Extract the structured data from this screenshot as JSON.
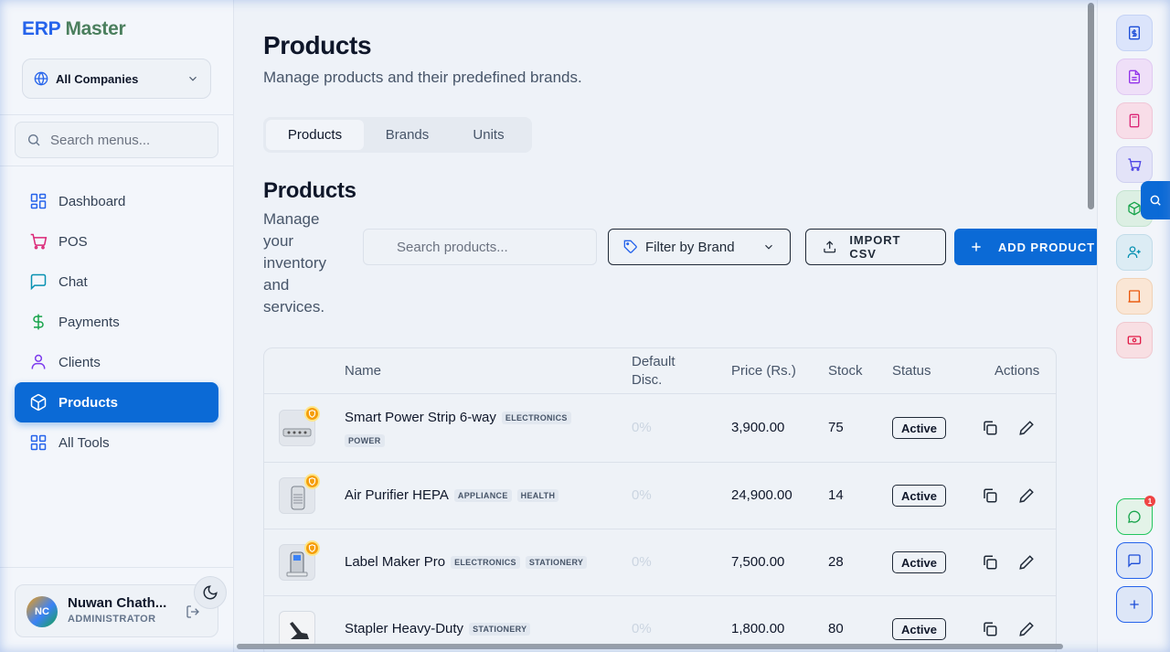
{
  "app": {
    "logo_part1": "ERP",
    "logo_part2": "Master"
  },
  "company_select": {
    "value": "All Companies"
  },
  "menu_search": {
    "placeholder": "Search menus..."
  },
  "nav": {
    "items": [
      {
        "label": "Dashboard",
        "icon": "grid-icon",
        "color": "#2563eb"
      },
      {
        "label": "POS",
        "icon": "cart-icon",
        "color": "#db2777"
      },
      {
        "label": "Chat",
        "icon": "chat-icon",
        "color": "#0891b2"
      },
      {
        "label": "Payments",
        "icon": "dollar-icon",
        "color": "#16a34a"
      },
      {
        "label": "Clients",
        "icon": "user-icon",
        "color": "#7c3aed"
      },
      {
        "label": "Products",
        "icon": "box-icon",
        "color": "#ffffff",
        "active": true
      },
      {
        "label": "All Tools",
        "icon": "grid-icon",
        "color": "#2563eb"
      }
    ]
  },
  "user": {
    "initials": "NC",
    "name": "Nuwan Chath...",
    "role": "ADMINISTRATOR"
  },
  "page": {
    "title": "Products",
    "subtitle": "Manage products and their predefined brands."
  },
  "tabs": [
    {
      "label": "Products",
      "active": true
    },
    {
      "label": "Brands"
    },
    {
      "label": "Units"
    }
  ],
  "section": {
    "title": "Products",
    "subtitle": "Manage your inventory and services."
  },
  "toolbar": {
    "search_placeholder": "Search products...",
    "brand_filter": "Filter by Brand",
    "import_label": "IMPORT CSV",
    "add_label": "ADD PRODUCT"
  },
  "table": {
    "headers": {
      "name": "Name",
      "disc": "Default Disc.",
      "price": "Price (Rs.)",
      "stock": "Stock",
      "status": "Status",
      "actions": "Actions"
    },
    "rows": [
      {
        "name": "Smart Power Strip 6-way",
        "tags": [
          "ELECTRONICS",
          "POWER"
        ],
        "disc": "0%",
        "price": "3,900.00",
        "stock": "75",
        "status": "Active",
        "badge": true
      },
      {
        "name": "Air Purifier HEPA",
        "tags": [
          "APPLIANCE",
          "HEALTH"
        ],
        "disc": "0%",
        "price": "24,900.00",
        "stock": "14",
        "status": "Active",
        "badge": true
      },
      {
        "name": "Label Maker Pro",
        "tags": [
          "ELECTRONICS",
          "STATIONERY"
        ],
        "disc": "0%",
        "price": "7,500.00",
        "stock": "28",
        "status": "Active",
        "badge": true
      },
      {
        "name": "Stapler Heavy-Duty",
        "tags": [
          "STATIONERY"
        ],
        "disc": "0%",
        "price": "1,800.00",
        "stock": "80",
        "status": "Active",
        "badge": false
      }
    ]
  },
  "rail": {
    "notification_count": "1",
    "buttons": [
      {
        "icon": "invoice-dollar-icon",
        "bg": "#dbe4fb",
        "fg": "#1d4ed8"
      },
      {
        "icon": "document-icon",
        "bg": "#efdff8",
        "fg": "#9333ea"
      },
      {
        "icon": "calculator-icon",
        "bg": "#f8dde8",
        "fg": "#db2777"
      },
      {
        "icon": "cart-icon",
        "bg": "#e3e3f8",
        "fg": "#4f46e5"
      },
      {
        "icon": "box-icon",
        "bg": "#dcefe3",
        "fg": "#16a34a"
      },
      {
        "icon": "user-plus-icon",
        "bg": "#dcecf4",
        "fg": "#0891b2"
      },
      {
        "icon": "building-icon",
        "bg": "#fae6d5",
        "fg": "#ea580c"
      },
      {
        "icon": "cash-icon",
        "bg": "#f8dfe3",
        "fg": "#e11d48"
      }
    ]
  }
}
